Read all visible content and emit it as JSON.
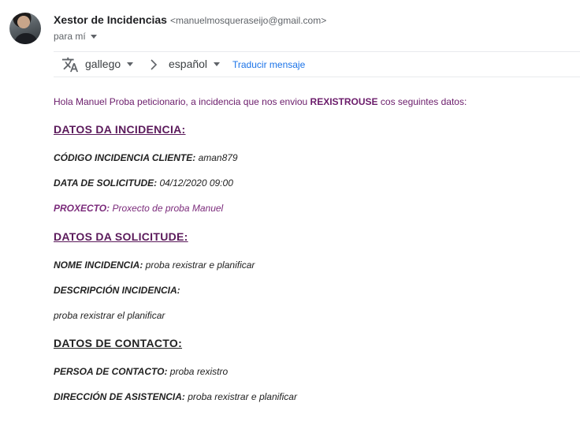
{
  "sender": {
    "name": "Xestor de Incidencias",
    "email": "<manuelmosqueraseijo@gmail.com>",
    "recipient_label": "para mí"
  },
  "translate_bar": {
    "source_language": "gallego",
    "target_language": "español",
    "translate_link": "Traducir mensaje"
  },
  "message": {
    "intro_prefix": "Hola Manuel Proba peticionario, a incidencia que nos enviou ",
    "intro_emphasis": "REXISTROUSE",
    "intro_suffix": " cos seguintes datos:",
    "sections": {
      "incidencia": {
        "title": "DATOS DA INCIDENCIA:",
        "codigo_label": "CÓDIGO INCIDENCIA CLIENTE:",
        "codigo_value": " aman879",
        "data_label": "DATA DE SOLICITUDE:",
        "data_value": " 04/12/2020 09:00",
        "proxecto_label": "PROXECTO:",
        "proxecto_value": " Proxecto de proba Manuel"
      },
      "solicitude": {
        "title": "DATOS DA SOLICITUDE:",
        "nome_label": "NOME INCIDENCIA:",
        "nome_value": " proba rexistrar e planificar",
        "descripcion_label": "DESCRIPCIÓN INCIDENCIA:",
        "descripcion_value": "proba rexistrar el planificar"
      },
      "contacto": {
        "title": "DATOS DE CONTACTO:",
        "persoa_label": "PERSOA DE CONTACTO:",
        "persoa_value": " proba rexistro",
        "direccion_label": "DIRECCIÓN DE ASISTENCIA:",
        "direccion_value": " proba rexistrar e planificar"
      }
    }
  },
  "colors": {
    "purple_text": "#6b1c6b",
    "link_blue": "#1a73e8",
    "muted_gray": "#5f6368"
  },
  "icons": {
    "translate": "translate-icon",
    "arrow": "chevron-right-icon",
    "caret": "caret-down-icon"
  }
}
